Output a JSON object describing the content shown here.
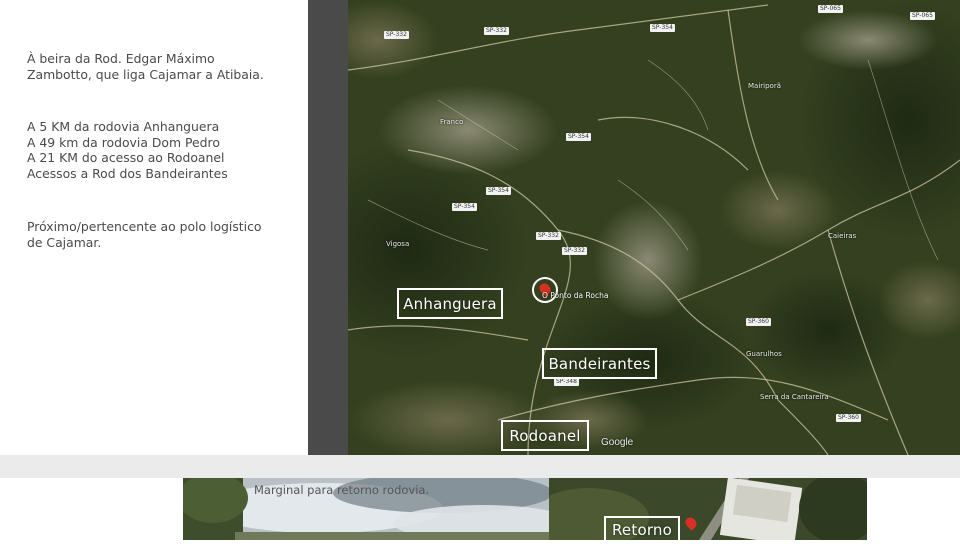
{
  "description": {
    "paragraph1": [
      "À beira da Rod. Edgar Máximo",
      "Zambotto, que liga Cajamar a Atibaia."
    ],
    "paragraph2": [
      "A 5 KM da rodovia Anhanguera",
      "A 49 km da rodovia Dom Pedro",
      "A 21 KM do acesso ao Rodoanel",
      "Acessos a Rod dos Bandeirantes"
    ],
    "paragraph3": [
      "Próximo/pertencente ao polo logístico",
      "de Cajamar."
    ]
  },
  "map": {
    "labels": {
      "anhanguera": "Anhanguera",
      "bandeirantes": "Bandeirantes",
      "rodoanel": "Rodoanel"
    },
    "pin_caption": "O Ponto da Rocha",
    "watermark": "Google",
    "colors": {
      "pin": "#d93025",
      "label_border": "#ffffff",
      "strip": "#4a4a4a"
    }
  },
  "photos": {
    "left_caption": "Marginal para retorno rodovia.",
    "right_label": "Retorno"
  }
}
